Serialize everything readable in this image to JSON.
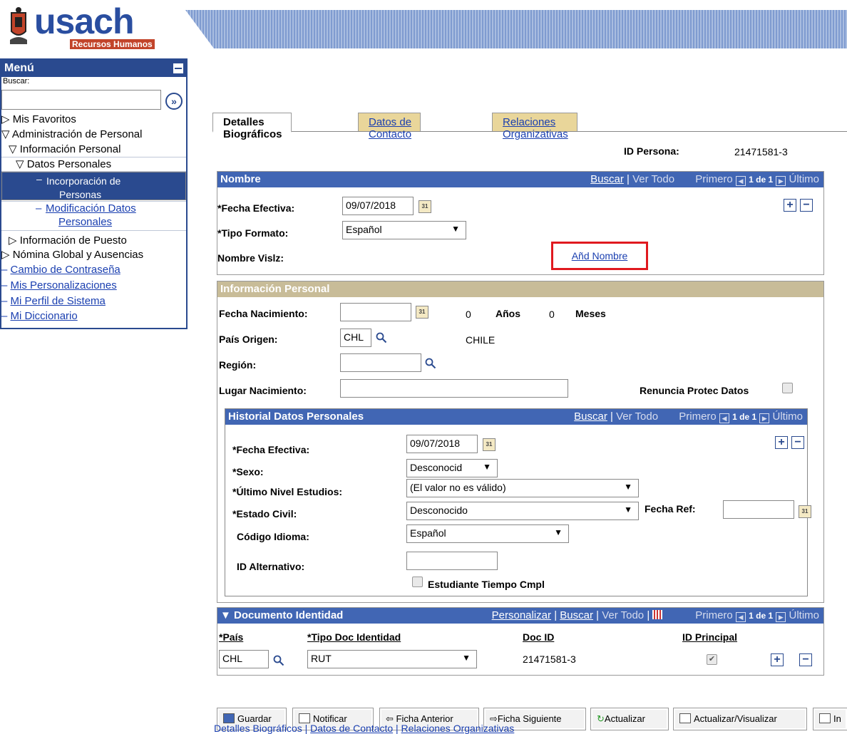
{
  "header": {
    "logo_text": "usach",
    "logo_sub": "Recursos Humanos"
  },
  "menu": {
    "title": "Menú",
    "buscar_label": "Buscar:",
    "search_value": "",
    "items": [
      {
        "label": "Mis Favoritos"
      },
      {
        "label": "Administración de Personal"
      },
      {
        "label": "Información Personal"
      },
      {
        "label": "Datos Personales"
      },
      {
        "label": "Incorporación de"
      },
      {
        "label": "Personas"
      },
      {
        "label": "Modificación Datos"
      },
      {
        "label": "Personales"
      },
      {
        "label": "Información de Puesto"
      },
      {
        "label": "Nómina Global y Ausencias"
      },
      {
        "label": "Cambio de Contraseña"
      },
      {
        "label": "Mis Personalizaciones"
      },
      {
        "label": "Mi Perfil de Sistema"
      },
      {
        "label": "Mi Diccionario"
      }
    ]
  },
  "tabs": [
    {
      "label": "Detalles Biográficos"
    },
    {
      "label": "Datos de Contacto"
    },
    {
      "label": "Relaciones Organizativas"
    }
  ],
  "id_persona": {
    "label": "ID Persona:",
    "value": "21471581-3"
  },
  "nombre": {
    "title": "Nombre",
    "buscar": "Buscar",
    "sep": "|",
    "ver_todo": "Ver Todo",
    "primero": "Primero",
    "count": "1 de 1",
    "ultimo": "Último",
    "fecha_label": "*Fecha Efectiva:",
    "fecha_value": "09/07/2018",
    "tipo_label": "*Tipo Formato:",
    "tipo_value": "Español",
    "visiz_label": "Nombre Vislz:",
    "add_link": "Añd Nombre"
  },
  "info_personal": {
    "title": "Información Personal",
    "fecha_nac_label": "Fecha Nacimiento:",
    "fecha_nac_value": "",
    "anos_value": "0",
    "anos_label": "Años",
    "meses_value": "0",
    "meses_label": "Meses",
    "pais_label": "País Origen:",
    "pais_value": "CHL",
    "pais_name": "CHILE",
    "region_label": "Región:",
    "region_value": "",
    "lugar_label": "Lugar Nacimiento:",
    "lugar_value": "",
    "renuncia_label": "Renuncia Protec Datos"
  },
  "historial": {
    "title": "Historial Datos Personales",
    "buscar": "Buscar",
    "ver_todo": "Ver Todo",
    "primero": "Primero",
    "count": "1 de 1",
    "ultimo": "Último",
    "fecha_label": "*Fecha Efectiva:",
    "fecha_value": "09/07/2018",
    "sexo_label": "*Sexo:",
    "sexo_value": "Desconocid",
    "nivel_label": "*Último Nivel Estudios:",
    "nivel_value": "(El valor no es válido)",
    "civil_label": "*Estado Civil:",
    "civil_value": "Desconocido",
    "fecha_ref_label": "Fecha Ref:",
    "fecha_ref_value": "",
    "idioma_label": "Código Idioma:",
    "idioma_value": "Español",
    "id_alt_label": "ID Alternativo:",
    "id_alt_value": "",
    "estudiante_label": "Estudiante Tiempo Cmpl"
  },
  "documento": {
    "title": "Documento Identidad",
    "personalizar": "Personalizar",
    "buscar": "Buscar",
    "ver_todo": "Ver Todo",
    "primero": "Primero",
    "count": "1 de 1",
    "ultimo": "Último",
    "col_pais": "*País",
    "col_tipo": "*Tipo Doc Identidad",
    "col_doc": "Doc ID",
    "col_principal": "ID Principal",
    "row_pais": "CHL",
    "row_tipo": "RUT",
    "row_doc": "21471581-3",
    "row_principal_checked": true
  },
  "buttons": {
    "guardar": "Guardar",
    "notificar": "Notificar",
    "anterior": "Ficha Anterior",
    "siguiente": "Ficha Siguiente",
    "actualizar": "Actualizar",
    "act_vis": "Actualizar/Visualizar",
    "incluir": "In"
  },
  "footer_links": {
    "l1": "Detalles Biográficos",
    "l2": "Datos de Contacto",
    "l3": "Relaciones Organizativas",
    "sep": "|"
  },
  "colors": {
    "brand_blue": "#2a4a8f",
    "header_blue": "#4166b4",
    "tab_tan": "#e9d69a",
    "highlight_red": "#e0191f"
  }
}
